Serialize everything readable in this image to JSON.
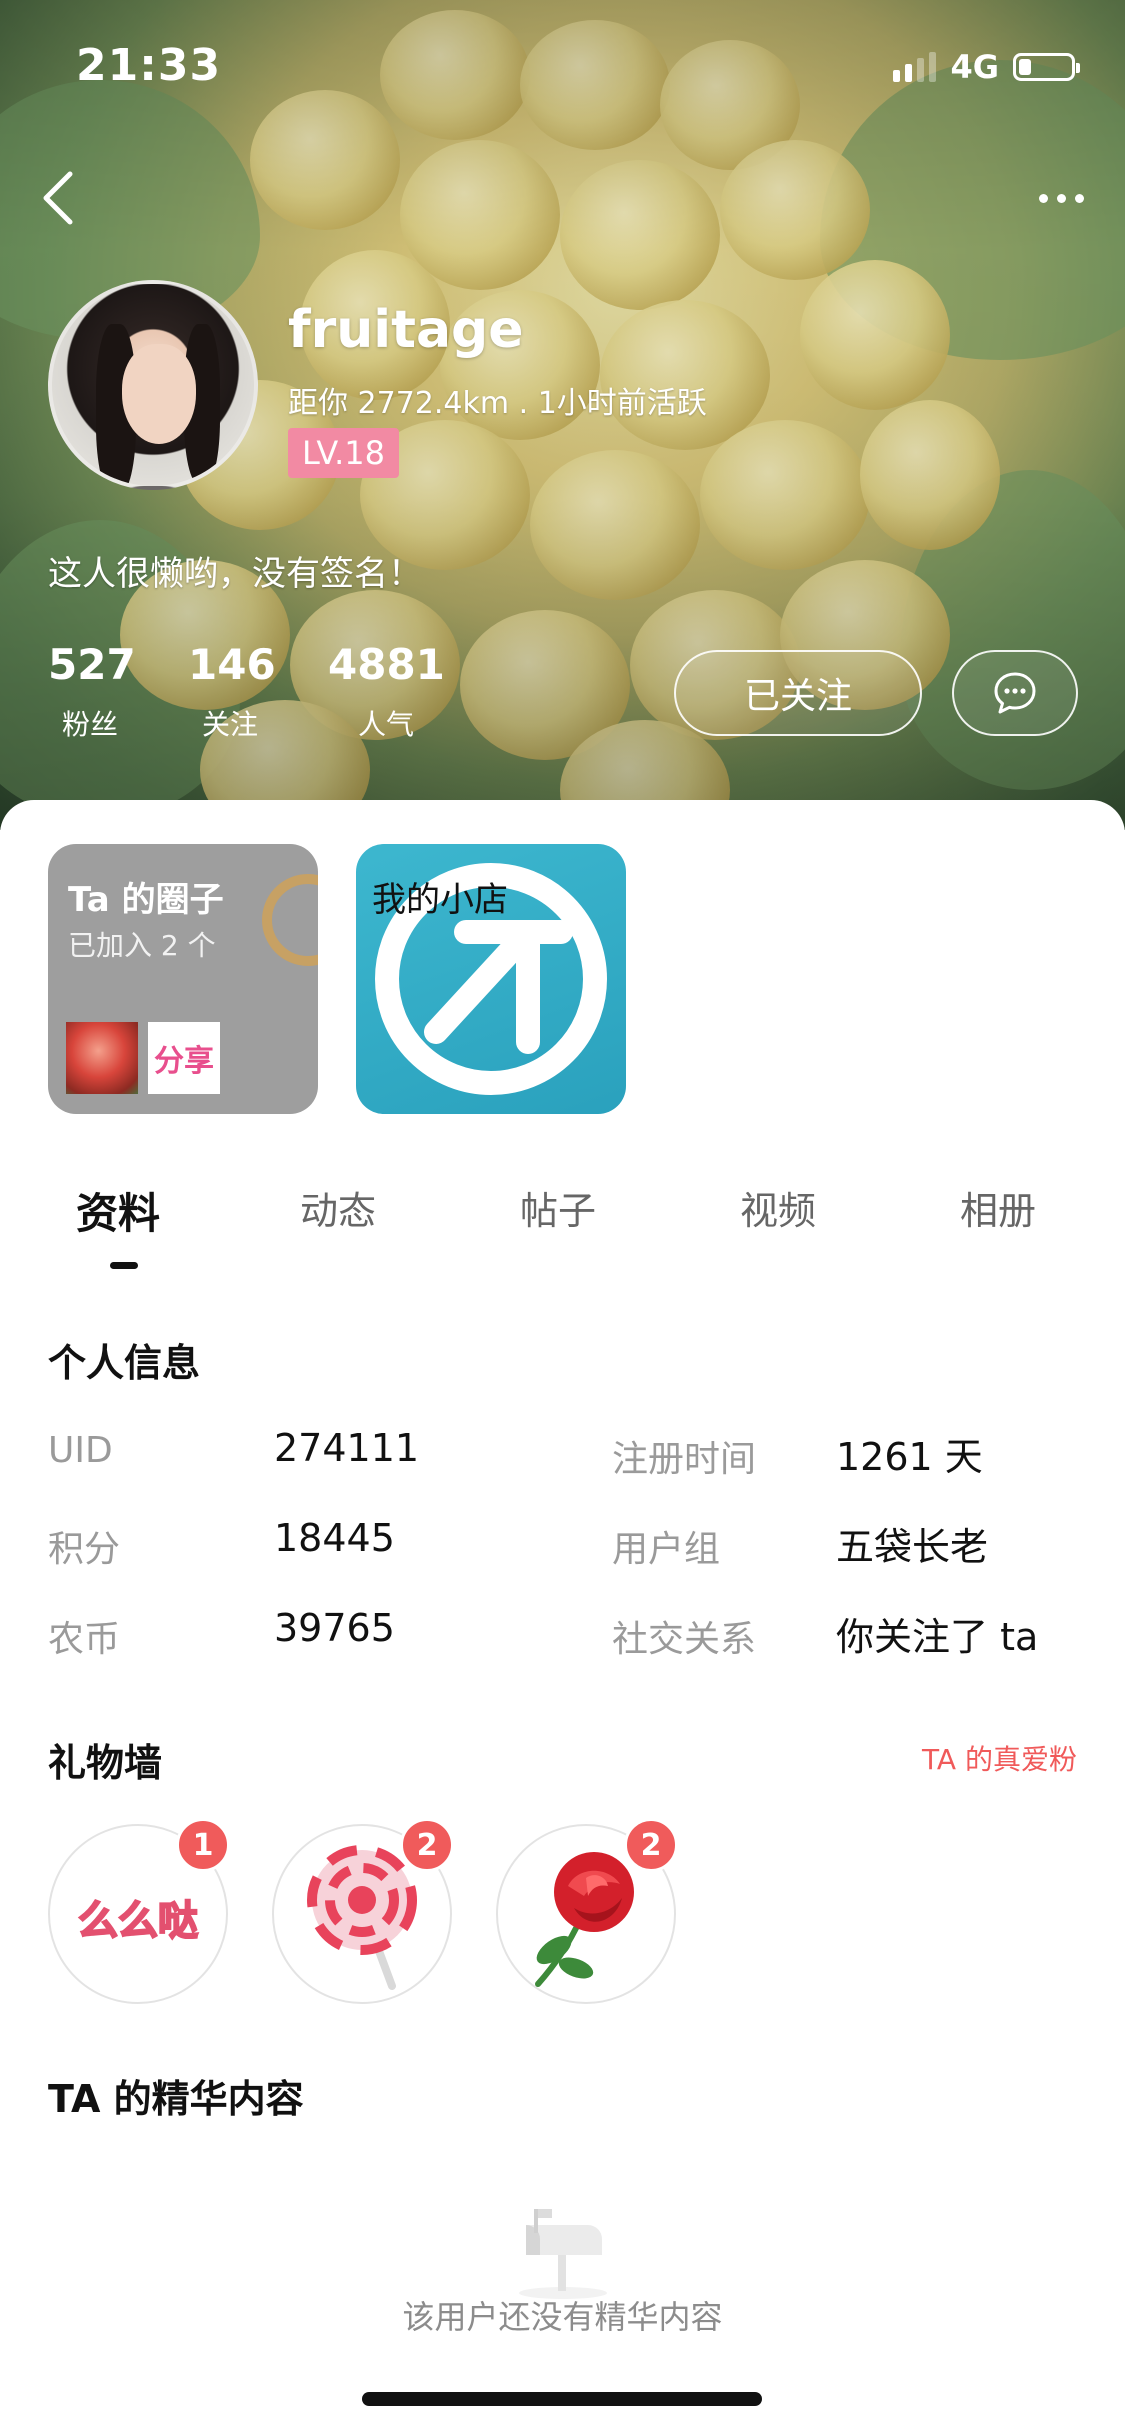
{
  "status_bar": {
    "time": "21:33",
    "network": "4G"
  },
  "profile": {
    "username": "fruitage",
    "distance_activity": "距你 2772.4km . 1小时前活跃",
    "level": "LV.18",
    "signature": "这人很懒哟，没有签名！",
    "stats": [
      {
        "value": "527",
        "label": "粉丝"
      },
      {
        "value": "146",
        "label": "关注"
      },
      {
        "value": "4881",
        "label": "人气"
      }
    ],
    "follow_button": "已关注"
  },
  "cards": {
    "circle": {
      "title": "Ta 的圈子",
      "subtitle": "已加入 2 个",
      "thumb_text": "分享"
    },
    "shop": {
      "title": "我的小店"
    }
  },
  "tabs": [
    "资料",
    "动态",
    "帖子",
    "视频",
    "相册"
  ],
  "personal_info": {
    "title": "个人信息",
    "rows": [
      {
        "left_label": "UID",
        "left_value": "274111",
        "right_label": "注册时间",
        "right_value": "1261 天"
      },
      {
        "left_label": "积分",
        "left_value": "18445",
        "right_label": "用户组",
        "right_value": "五袋长老"
      },
      {
        "left_label": "农币",
        "left_value": "39765",
        "right_label": "社交关系",
        "right_value": "你关注了 ta"
      }
    ]
  },
  "gift_wall": {
    "title": "礼物墙",
    "link": "TA 的真爱粉",
    "gifts": [
      {
        "name": "kiss-sticker",
        "text": "么么哒",
        "count": "1"
      },
      {
        "name": "lollipop",
        "count": "2"
      },
      {
        "name": "rose",
        "count": "2"
      }
    ]
  },
  "essence": {
    "title": "TA 的精华内容",
    "empty_text": "该用户还没有精华内容"
  }
}
